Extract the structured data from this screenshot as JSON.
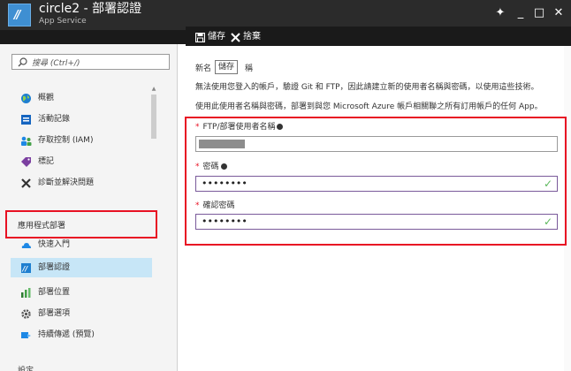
{
  "window": {
    "title": "circle2 - 部署認證",
    "subtitle": "App Service",
    "pin_glyph": "✦",
    "minimize_glyph": "_",
    "maximize_glyph": "□",
    "close_glyph": "✕"
  },
  "commands": {
    "save_label": "儲存",
    "discard_label": "捨棄"
  },
  "search": {
    "placeholder": "搜尋 (Ctrl+/)"
  },
  "sidebar": {
    "items": [
      {
        "label": "概觀",
        "icon": "globe-icon"
      },
      {
        "label": "活動記錄",
        "icon": "activity-log-icon"
      },
      {
        "label": "存取控制 (IAM)",
        "icon": "users-icon"
      },
      {
        "label": "標記",
        "icon": "tag-icon"
      },
      {
        "label": "診斷並解決問題",
        "icon": "tools-icon"
      }
    ],
    "section_title": "應用程式部署",
    "deploy_items": [
      {
        "label": "快速入門",
        "icon": "cloud-icon"
      },
      {
        "label": "部署認證",
        "icon": "credentials-icon",
        "active": true
      },
      {
        "label": "部署位置",
        "icon": "slots-icon"
      },
      {
        "label": "部署選項",
        "icon": "gear-icon"
      },
      {
        "label": "持續傳遞 (預覽)",
        "icon": "delivery-icon"
      }
    ],
    "next_section_title": "設定"
  },
  "main": {
    "heading_prefix": "新名",
    "heading_suffix": "稱",
    "tooltip": "儲存",
    "line1": "無法使用您登入的帳戶，驗證 Git 和 FTP，因此請建立新的使用者名稱與密碼，以使用這些技術。",
    "line2": "使用此使用者名稱與密碼，部署到與您 Microsoft Azure 帳戶相關聯之所有訂用帳戶的任何 App。",
    "fields": {
      "username_label": "FTP/部署使用者名稱",
      "password_label": "密碼",
      "confirm_label": "確認密碼",
      "password_value": "••••••••",
      "confirm_value": "••••••••"
    }
  },
  "colors": {
    "highlight_border": "#e81123",
    "active_item_bg": "#c7e6f7",
    "valid_check": "#5cb85c"
  }
}
